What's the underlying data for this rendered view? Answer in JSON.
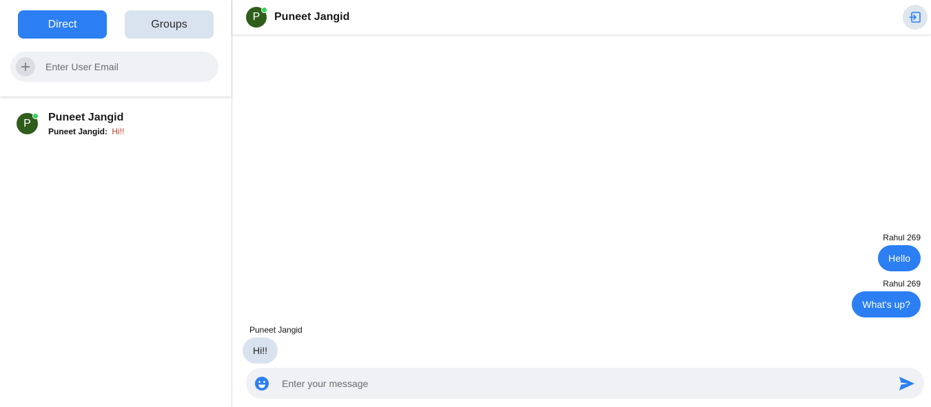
{
  "sidebar": {
    "tabs": [
      {
        "label": "Direct",
        "active": true
      },
      {
        "label": "Groups",
        "active": false
      }
    ],
    "search": {
      "placeholder": "Enter User Email",
      "value": "",
      "icon": "plus-icon"
    },
    "conversations": [
      {
        "avatar_letter": "P",
        "online": true,
        "name": "Puneet Jangid",
        "preview_sender": "Puneet Jangid:",
        "preview_text": "Hi!!"
      }
    ]
  },
  "chat": {
    "header": {
      "avatar_letter": "P",
      "online": true,
      "name": "Puneet Jangid",
      "logout_icon": "logout-icon"
    },
    "messages": [
      {
        "author": "Rahul 269",
        "text": "Hello",
        "outgoing": true
      },
      {
        "author": "Rahul 269",
        "text": "What's up?",
        "outgoing": true
      },
      {
        "author": "Puneet Jangid",
        "text": "Hi!!",
        "outgoing": false
      }
    ],
    "composer": {
      "placeholder": "Enter your message",
      "value": "",
      "emoji_icon": "emoji-icon",
      "send_icon": "send-icon"
    }
  },
  "colors": {
    "accent": "#2b7ff2",
    "inactive_tab": "#d9e3ef",
    "avatar_bg": "#2f5d1c",
    "online": "#35d25a",
    "input_bg": "#f0f1f5"
  }
}
